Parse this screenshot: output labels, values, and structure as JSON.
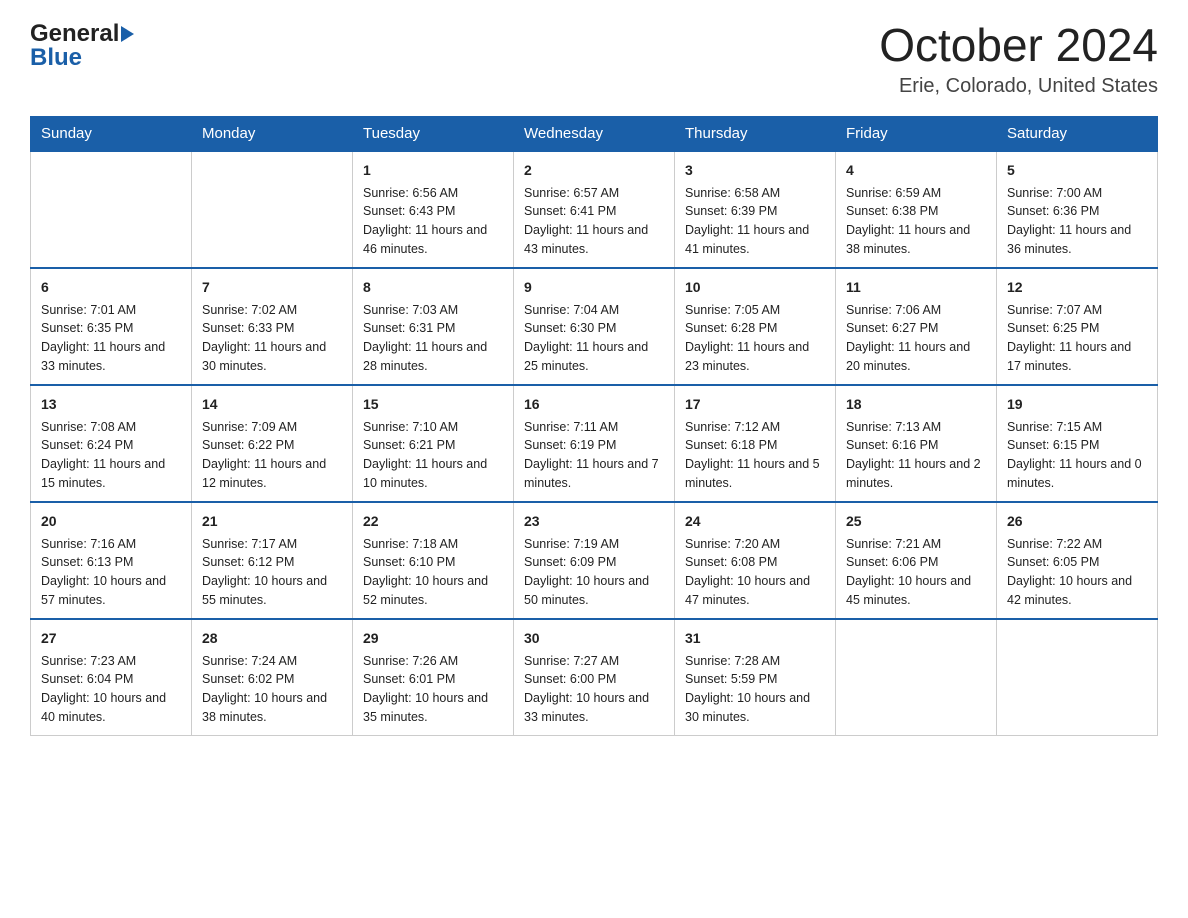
{
  "header": {
    "logo_general": "General",
    "logo_blue": "Blue",
    "month_title": "October 2024",
    "location": "Erie, Colorado, United States"
  },
  "days_of_week": [
    "Sunday",
    "Monday",
    "Tuesday",
    "Wednesday",
    "Thursday",
    "Friday",
    "Saturday"
  ],
  "weeks": [
    [
      {
        "day": "",
        "info": ""
      },
      {
        "day": "",
        "info": ""
      },
      {
        "day": "1",
        "sunrise": "Sunrise: 6:56 AM",
        "sunset": "Sunset: 6:43 PM",
        "daylight": "Daylight: 11 hours and 46 minutes."
      },
      {
        "day": "2",
        "sunrise": "Sunrise: 6:57 AM",
        "sunset": "Sunset: 6:41 PM",
        "daylight": "Daylight: 11 hours and 43 minutes."
      },
      {
        "day": "3",
        "sunrise": "Sunrise: 6:58 AM",
        "sunset": "Sunset: 6:39 PM",
        "daylight": "Daylight: 11 hours and 41 minutes."
      },
      {
        "day": "4",
        "sunrise": "Sunrise: 6:59 AM",
        "sunset": "Sunset: 6:38 PM",
        "daylight": "Daylight: 11 hours and 38 minutes."
      },
      {
        "day": "5",
        "sunrise": "Sunrise: 7:00 AM",
        "sunset": "Sunset: 6:36 PM",
        "daylight": "Daylight: 11 hours and 36 minutes."
      }
    ],
    [
      {
        "day": "6",
        "sunrise": "Sunrise: 7:01 AM",
        "sunset": "Sunset: 6:35 PM",
        "daylight": "Daylight: 11 hours and 33 minutes."
      },
      {
        "day": "7",
        "sunrise": "Sunrise: 7:02 AM",
        "sunset": "Sunset: 6:33 PM",
        "daylight": "Daylight: 11 hours and 30 minutes."
      },
      {
        "day": "8",
        "sunrise": "Sunrise: 7:03 AM",
        "sunset": "Sunset: 6:31 PM",
        "daylight": "Daylight: 11 hours and 28 minutes."
      },
      {
        "day": "9",
        "sunrise": "Sunrise: 7:04 AM",
        "sunset": "Sunset: 6:30 PM",
        "daylight": "Daylight: 11 hours and 25 minutes."
      },
      {
        "day": "10",
        "sunrise": "Sunrise: 7:05 AM",
        "sunset": "Sunset: 6:28 PM",
        "daylight": "Daylight: 11 hours and 23 minutes."
      },
      {
        "day": "11",
        "sunrise": "Sunrise: 7:06 AM",
        "sunset": "Sunset: 6:27 PM",
        "daylight": "Daylight: 11 hours and 20 minutes."
      },
      {
        "day": "12",
        "sunrise": "Sunrise: 7:07 AM",
        "sunset": "Sunset: 6:25 PM",
        "daylight": "Daylight: 11 hours and 17 minutes."
      }
    ],
    [
      {
        "day": "13",
        "sunrise": "Sunrise: 7:08 AM",
        "sunset": "Sunset: 6:24 PM",
        "daylight": "Daylight: 11 hours and 15 minutes."
      },
      {
        "day": "14",
        "sunrise": "Sunrise: 7:09 AM",
        "sunset": "Sunset: 6:22 PM",
        "daylight": "Daylight: 11 hours and 12 minutes."
      },
      {
        "day": "15",
        "sunrise": "Sunrise: 7:10 AM",
        "sunset": "Sunset: 6:21 PM",
        "daylight": "Daylight: 11 hours and 10 minutes."
      },
      {
        "day": "16",
        "sunrise": "Sunrise: 7:11 AM",
        "sunset": "Sunset: 6:19 PM",
        "daylight": "Daylight: 11 hours and 7 minutes."
      },
      {
        "day": "17",
        "sunrise": "Sunrise: 7:12 AM",
        "sunset": "Sunset: 6:18 PM",
        "daylight": "Daylight: 11 hours and 5 minutes."
      },
      {
        "day": "18",
        "sunrise": "Sunrise: 7:13 AM",
        "sunset": "Sunset: 6:16 PM",
        "daylight": "Daylight: 11 hours and 2 minutes."
      },
      {
        "day": "19",
        "sunrise": "Sunrise: 7:15 AM",
        "sunset": "Sunset: 6:15 PM",
        "daylight": "Daylight: 11 hours and 0 minutes."
      }
    ],
    [
      {
        "day": "20",
        "sunrise": "Sunrise: 7:16 AM",
        "sunset": "Sunset: 6:13 PM",
        "daylight": "Daylight: 10 hours and 57 minutes."
      },
      {
        "day": "21",
        "sunrise": "Sunrise: 7:17 AM",
        "sunset": "Sunset: 6:12 PM",
        "daylight": "Daylight: 10 hours and 55 minutes."
      },
      {
        "day": "22",
        "sunrise": "Sunrise: 7:18 AM",
        "sunset": "Sunset: 6:10 PM",
        "daylight": "Daylight: 10 hours and 52 minutes."
      },
      {
        "day": "23",
        "sunrise": "Sunrise: 7:19 AM",
        "sunset": "Sunset: 6:09 PM",
        "daylight": "Daylight: 10 hours and 50 minutes."
      },
      {
        "day": "24",
        "sunrise": "Sunrise: 7:20 AM",
        "sunset": "Sunset: 6:08 PM",
        "daylight": "Daylight: 10 hours and 47 minutes."
      },
      {
        "day": "25",
        "sunrise": "Sunrise: 7:21 AM",
        "sunset": "Sunset: 6:06 PM",
        "daylight": "Daylight: 10 hours and 45 minutes."
      },
      {
        "day": "26",
        "sunrise": "Sunrise: 7:22 AM",
        "sunset": "Sunset: 6:05 PM",
        "daylight": "Daylight: 10 hours and 42 minutes."
      }
    ],
    [
      {
        "day": "27",
        "sunrise": "Sunrise: 7:23 AM",
        "sunset": "Sunset: 6:04 PM",
        "daylight": "Daylight: 10 hours and 40 minutes."
      },
      {
        "day": "28",
        "sunrise": "Sunrise: 7:24 AM",
        "sunset": "Sunset: 6:02 PM",
        "daylight": "Daylight: 10 hours and 38 minutes."
      },
      {
        "day": "29",
        "sunrise": "Sunrise: 7:26 AM",
        "sunset": "Sunset: 6:01 PM",
        "daylight": "Daylight: 10 hours and 35 minutes."
      },
      {
        "day": "30",
        "sunrise": "Sunrise: 7:27 AM",
        "sunset": "Sunset: 6:00 PM",
        "daylight": "Daylight: 10 hours and 33 minutes."
      },
      {
        "day": "31",
        "sunrise": "Sunrise: 7:28 AM",
        "sunset": "Sunset: 5:59 PM",
        "daylight": "Daylight: 10 hours and 30 minutes."
      },
      {
        "day": "",
        "info": ""
      },
      {
        "day": "",
        "info": ""
      }
    ]
  ]
}
